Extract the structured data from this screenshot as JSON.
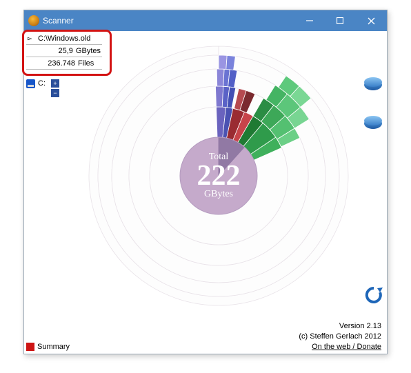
{
  "window": {
    "title": "Scanner"
  },
  "selection": {
    "path": "C:\\Windows.old",
    "size_value": "25,9",
    "size_unit": "GBytes",
    "files_value": "236.748",
    "files_unit": "Files"
  },
  "sidebar": {
    "drive": "C:",
    "summary": "Summary"
  },
  "footer": {
    "version": "Version 2.13",
    "copyright": "(c) Steffen Gerlach 2012",
    "link": "On the web / Donate"
  },
  "chart_data": {
    "type": "sunburst",
    "center": {
      "top": "Total",
      "value": "222",
      "unit": "GBytes"
    },
    "total_gb": 222,
    "ring_radii": [
      56,
      100,
      130,
      155,
      175,
      188
    ],
    "empty_fill": "#fdfdfd",
    "empty_stroke": "#e8e2e8",
    "highlight_slice": {
      "ring": 0,
      "start_deg": 0,
      "end_deg": 42,
      "fill": "#9179a4",
      "label": "C:\\Windows.old 25.9 GB"
    },
    "center_fill": "#c5aacb",
    "slices": [
      {
        "ring": 0,
        "start_deg": 42,
        "end_deg": 360,
        "fill": "#c5aacb"
      },
      {
        "ring": 1,
        "start_deg": -2,
        "end_deg": 6,
        "fill": "#6a63be"
      },
      {
        "ring": 1,
        "start_deg": 6,
        "end_deg": 12,
        "fill": "#4b52b2"
      },
      {
        "ring": 1,
        "start_deg": 12,
        "end_deg": 22,
        "fill": "#9a2b32"
      },
      {
        "ring": 1,
        "start_deg": 22,
        "end_deg": 30,
        "fill": "#c7444a"
      },
      {
        "ring": 1,
        "start_deg": 30,
        "end_deg": 40,
        "fill": "#1f7a33"
      },
      {
        "ring": 1,
        "start_deg": 40,
        "end_deg": 56,
        "fill": "#2f9b4b"
      },
      {
        "ring": 1,
        "start_deg": 56,
        "end_deg": 66,
        "fill": "#3fb05c"
      },
      {
        "ring": 2,
        "start_deg": -2,
        "end_deg": 3,
        "fill": "#7e78cf"
      },
      {
        "ring": 2,
        "start_deg": 3,
        "end_deg": 7,
        "fill": "#5a62c6"
      },
      {
        "ring": 2,
        "start_deg": 7,
        "end_deg": 11,
        "fill": "#4350b5"
      },
      {
        "ring": 2,
        "start_deg": 13,
        "end_deg": 18,
        "fill": "#b64a50"
      },
      {
        "ring": 2,
        "start_deg": 18,
        "end_deg": 24,
        "fill": "#7b2a2f"
      },
      {
        "ring": 2,
        "start_deg": 30,
        "end_deg": 38,
        "fill": "#2b8d44"
      },
      {
        "ring": 2,
        "start_deg": 38,
        "end_deg": 48,
        "fill": "#3da858"
      },
      {
        "ring": 2,
        "start_deg": 48,
        "end_deg": 58,
        "fill": "#54c071"
      },
      {
        "ring": 2,
        "start_deg": 58,
        "end_deg": 65,
        "fill": "#6bcf86"
      },
      {
        "ring": 3,
        "start_deg": -1,
        "end_deg": 3,
        "fill": "#8b86d8"
      },
      {
        "ring": 3,
        "start_deg": 3,
        "end_deg": 6,
        "fill": "#6a73d2"
      },
      {
        "ring": 3,
        "start_deg": 6,
        "end_deg": 10,
        "fill": "#5360c7"
      },
      {
        "ring": 3,
        "start_deg": 32,
        "end_deg": 40,
        "fill": "#44b463"
      },
      {
        "ring": 3,
        "start_deg": 40,
        "end_deg": 50,
        "fill": "#5cc67a"
      },
      {
        "ring": 3,
        "start_deg": 50,
        "end_deg": 58,
        "fill": "#78d592"
      },
      {
        "ring": 4,
        "start_deg": 0,
        "end_deg": 4,
        "fill": "#9a95e2"
      },
      {
        "ring": 4,
        "start_deg": 4,
        "end_deg": 8,
        "fill": "#7a83dc"
      },
      {
        "ring": 4,
        "start_deg": 34,
        "end_deg": 42,
        "fill": "#5ec97c"
      },
      {
        "ring": 4,
        "start_deg": 42,
        "end_deg": 50,
        "fill": "#7ad794"
      }
    ]
  }
}
